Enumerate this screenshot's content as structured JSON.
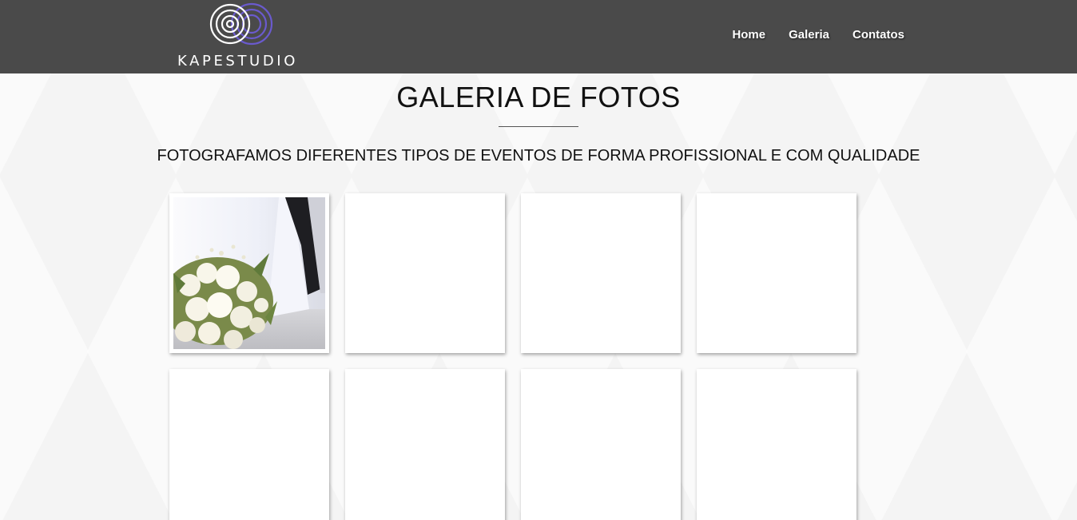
{
  "header": {
    "logo_text": "KAPESTUDIO",
    "nav": [
      {
        "label": "Home"
      },
      {
        "label": "Galeria"
      },
      {
        "label": "Contatos"
      }
    ]
  },
  "main": {
    "title": "GALERIA DE FOTOS",
    "subtitle": "FOTOGRAFAMOS DIFERENTES TIPOS DE EVENTOS DE FORMA PROFISSIONAL E COM QUALIDADE"
  },
  "gallery": {
    "thumbnails": [
      {
        "image": "wedding-bouquet-photo"
      },
      {
        "image": ""
      },
      {
        "image": ""
      },
      {
        "image": ""
      },
      {
        "image": ""
      },
      {
        "image": ""
      },
      {
        "image": ""
      },
      {
        "image": ""
      }
    ]
  },
  "colors": {
    "header_bg": "#4a4a4a",
    "logo_accent": "#6a5acd",
    "text": "#111111"
  }
}
